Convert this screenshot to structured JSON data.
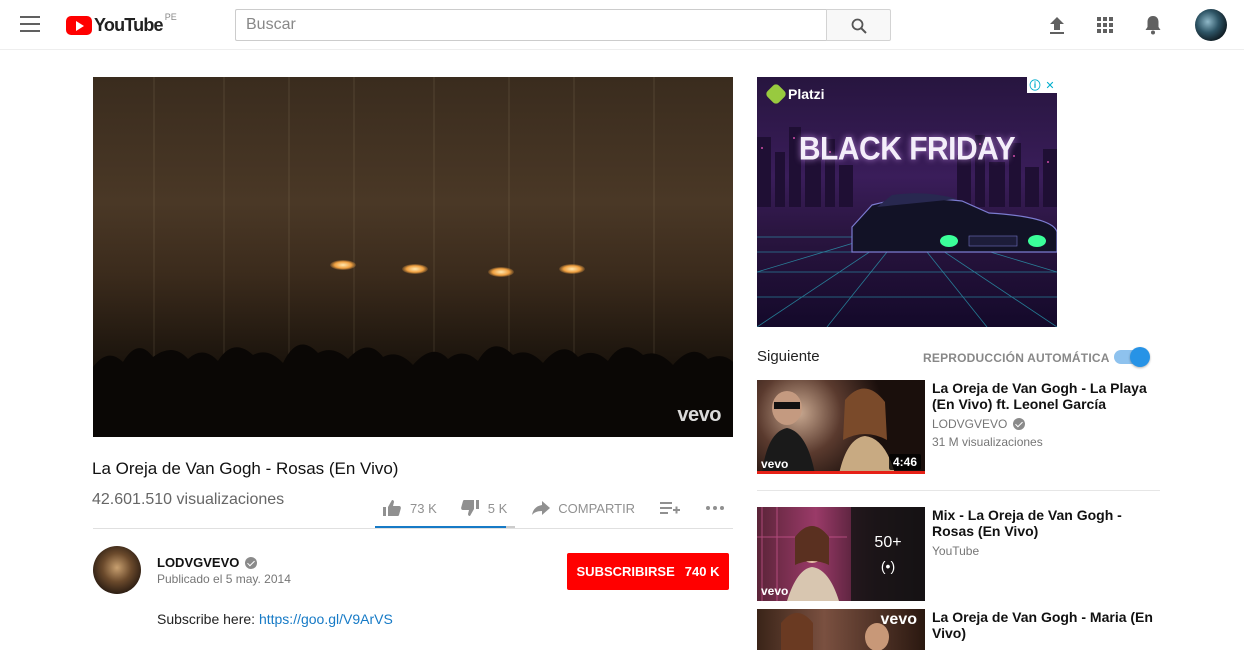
{
  "header": {
    "logo_text": "YouTube",
    "country_code": "PE",
    "search_placeholder": "Buscar",
    "icons": [
      "menu-icon",
      "search-icon",
      "upload-icon",
      "apps-icon",
      "notifications-icon"
    ]
  },
  "video": {
    "title": "La Oreja de Van Gogh - Rosas (En Vivo)",
    "views": "42.601.510 visualizaciones",
    "watermark": "vevo",
    "likes": "73 K",
    "dislikes": "5 K",
    "share_label": "COMPARTIR",
    "like_ratio": 0.936
  },
  "channel": {
    "name": "LODVGVEVO",
    "published": "Publicado el 5 may. 2014",
    "subscribe_label": "SUBSCRIBIRSE",
    "subscriber_count": "740 K"
  },
  "description": {
    "text": "Subscribe here: ",
    "link": "https://goo.gl/V9ArVS"
  },
  "ad": {
    "brand": "Platzi",
    "headline": "BLACK FRIDAY"
  },
  "sidebar": {
    "next_label": "Siguiente",
    "autoplay_label": "REPRODUCCIÓN AUTOMÁTICA",
    "autoplay_on": true,
    "recommendations": [
      {
        "title": "La Oreja de Van Gogh - La Playa (En Vivo) ft. Leonel García",
        "channel": "LODVGVEVO",
        "views": "31 M visualizaciones",
        "duration": "4:46",
        "badge": "vevo"
      },
      {
        "title": "Mix - La Oreja de Van Gogh - Rosas (En Vivo)",
        "channel": "YouTube",
        "mix_count": "50+",
        "badge": "vevo"
      },
      {
        "title": "La Oreja de Van Gogh - Maria (En Vivo)",
        "badge": "vevo"
      }
    ]
  },
  "colors": {
    "brand_red": "#ff0000",
    "link_blue": "#167ac6",
    "toggle_blue": "#2793e6"
  }
}
